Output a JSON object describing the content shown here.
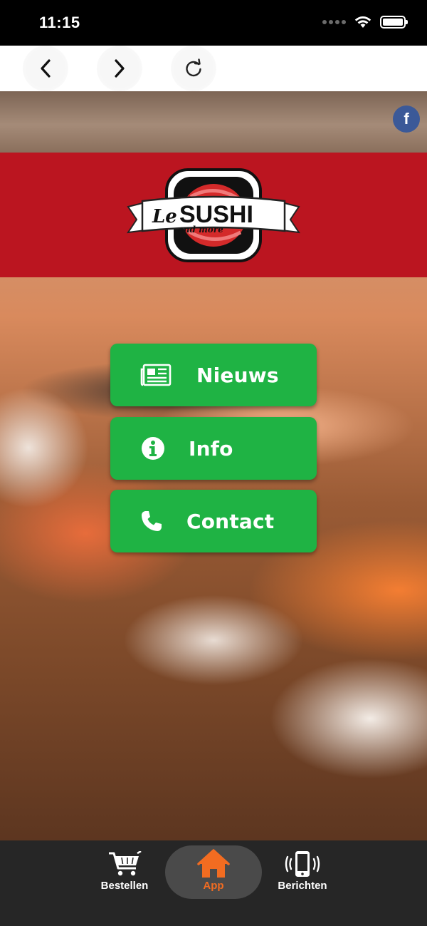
{
  "status_bar": {
    "time": "11:15"
  },
  "browser_nav": {
    "back_icon": "chevron-left-icon",
    "forward_icon": "chevron-right-icon",
    "reload_icon": "reload-icon"
  },
  "header": {
    "facebook_icon": "facebook-icon",
    "facebook_glyph": "f",
    "logo": {
      "brand_main": "SUSHI",
      "brand_prefix": "Le",
      "brand_tagline": "and more"
    },
    "band_color": "#bb1520"
  },
  "menu": {
    "button_color": "#1fb344",
    "items": [
      {
        "label": "Nieuws",
        "icon": "newspaper-icon"
      },
      {
        "label": "Info",
        "icon": "info-icon"
      },
      {
        "label": "Contact",
        "icon": "phone-icon"
      }
    ]
  },
  "tab_bar": {
    "active_color": "#f26c21",
    "tabs": [
      {
        "label": "Bestellen",
        "icon": "cart-icon"
      },
      {
        "label": "App",
        "icon": "home-icon",
        "active": true
      },
      {
        "label": "Berichten",
        "icon": "phone-vibrate-icon"
      }
    ]
  }
}
